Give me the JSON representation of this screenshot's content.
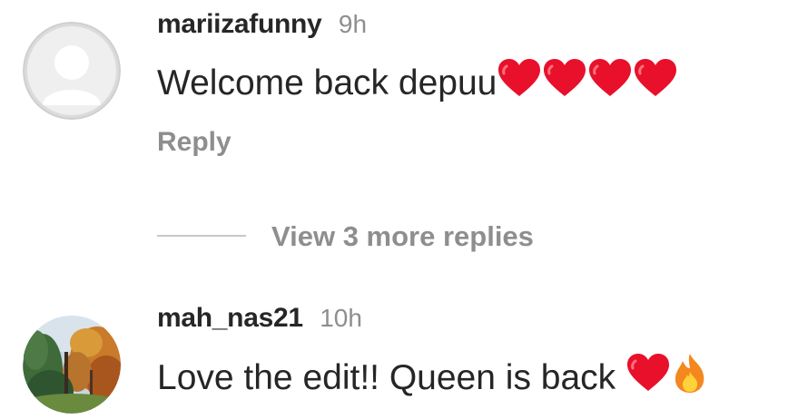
{
  "comments": [
    {
      "username": "mariizafunny",
      "time": "9h",
      "text": "Welcome back depuu",
      "emojis": [
        "red-heart",
        "red-heart",
        "red-heart",
        "red-heart"
      ],
      "reply_label": "Reply"
    },
    {
      "username": "mah_nas21",
      "time": "10h",
      "text": "Love the edit!! Queen is back ",
      "emojis": [
        "red-heart",
        "fire"
      ]
    }
  ],
  "view_replies": {
    "label": "View 3 more replies"
  },
  "colors": {
    "text": "#262626",
    "secondary": "#8e8e8e",
    "divider": "#c7c7c7",
    "heart": "#e8102b",
    "fire": "#f5871f"
  }
}
